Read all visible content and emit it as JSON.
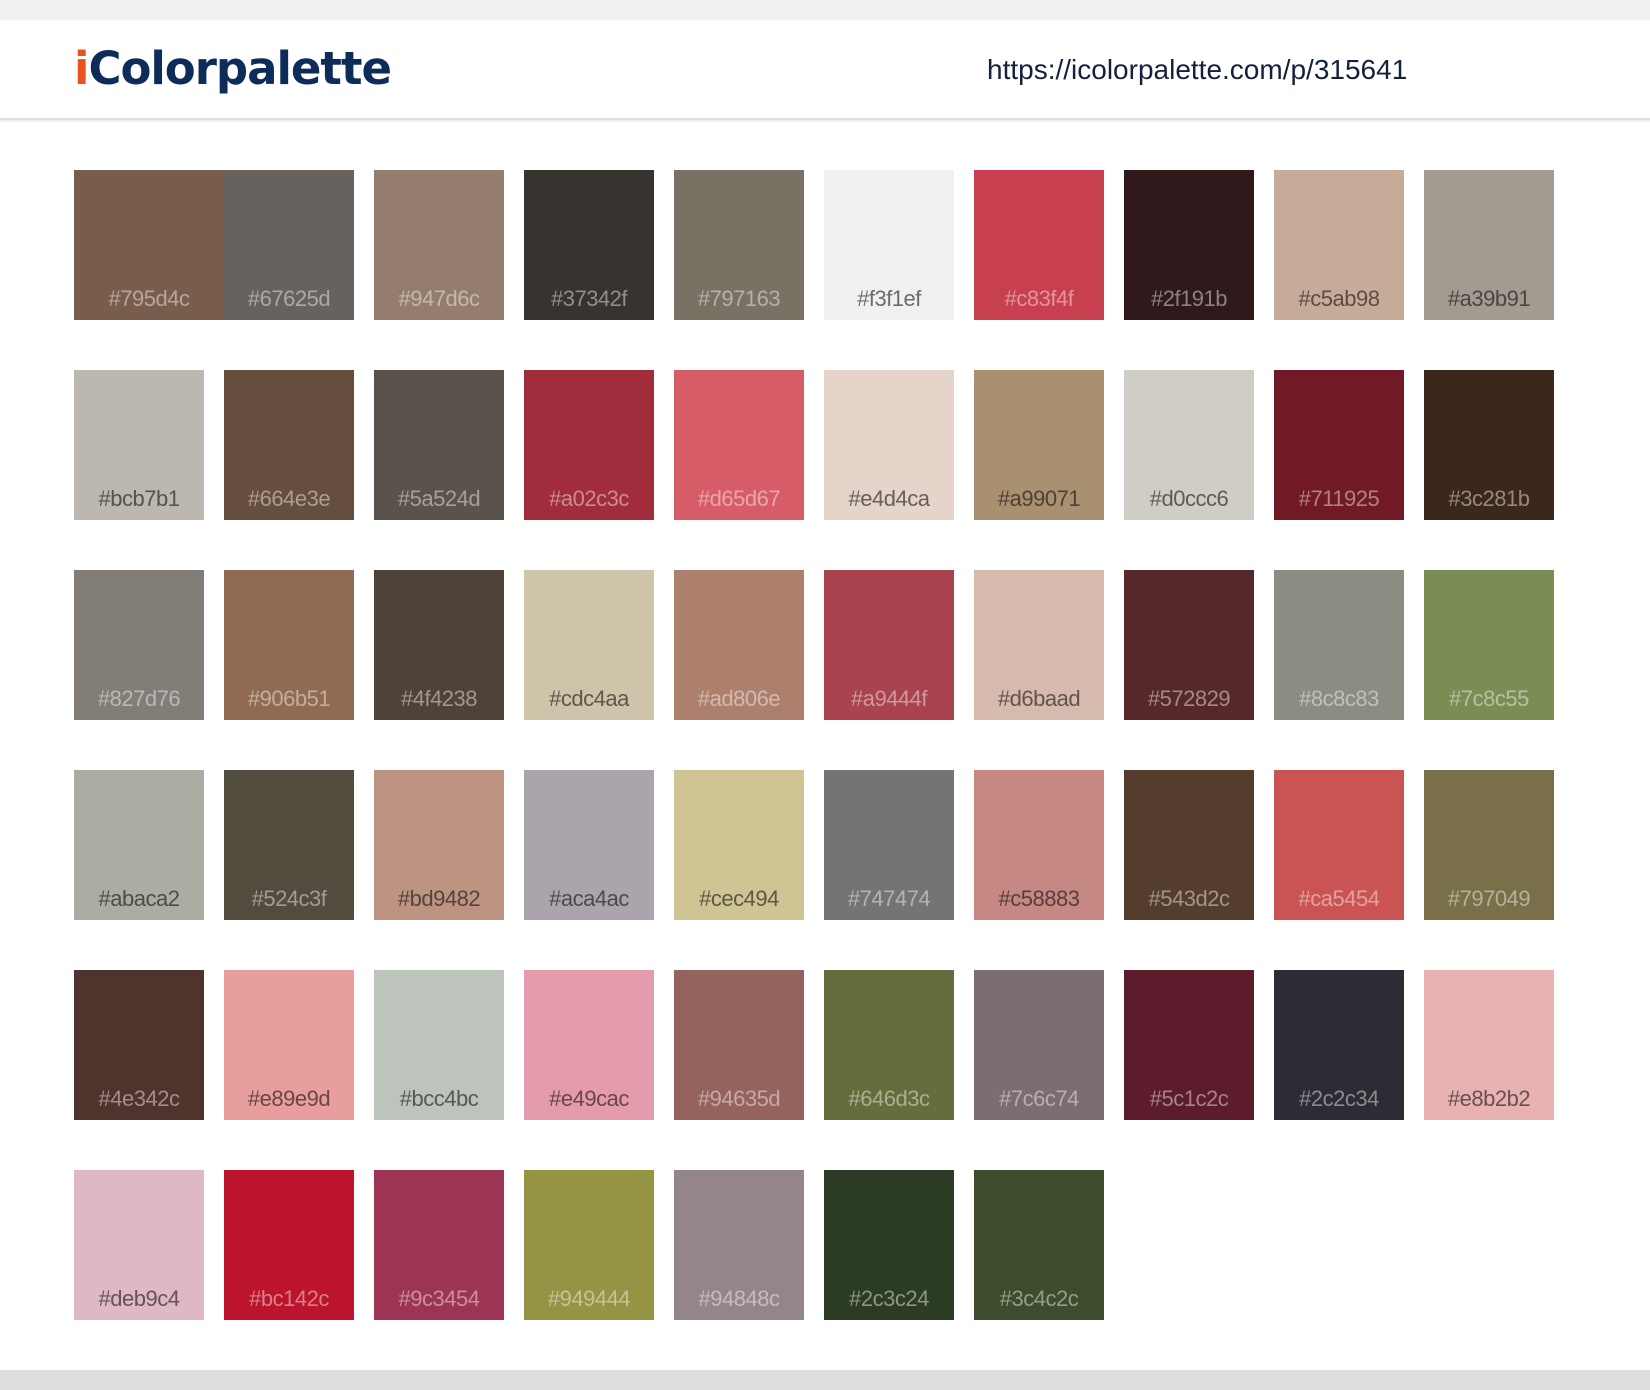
{
  "header": {
    "logo_prefix": "i",
    "logo_rest": "Colorpalette",
    "url": "https://icolorpalette.com/p/315641"
  },
  "colors": [
    "#795d4c",
    "#67625d",
    "#947d6c",
    "#37342f",
    "#797163",
    "#f3f1ef",
    "#c83f4f",
    "#2f191b",
    "#c5ab98",
    "#a39b91",
    "#bcb7b1",
    "#664e3e",
    "#5a524d",
    "#a02c3c",
    "#d65d67",
    "#e4d4ca",
    "#a99071",
    "#d0ccc6",
    "#711925",
    "#3c281b",
    "#827d76",
    "#906b51",
    "#4f4238",
    "#cdc4aa",
    "#ad806e",
    "#a9444f",
    "#d6baad",
    "#572829",
    "#8c8c83",
    "#7c8c55",
    "#abaca2",
    "#524c3f",
    "#bd9482",
    "#aca4ac",
    "#cec494",
    "#747474",
    "#c58883",
    "#543d2c",
    "#ca5454",
    "#797049",
    "#4e342c",
    "#e89e9d",
    "#bcc4bc",
    "#e49cac",
    "#94635d",
    "#646d3c",
    "#7c6c74",
    "#5c1c2c",
    "#2c2c34",
    "#e8b2b2",
    "#deb9c4",
    "#bc142c",
    "#9c3454",
    "#949444",
    "#94848c",
    "#2c3c24",
    "#3c4c2c"
  ]
}
